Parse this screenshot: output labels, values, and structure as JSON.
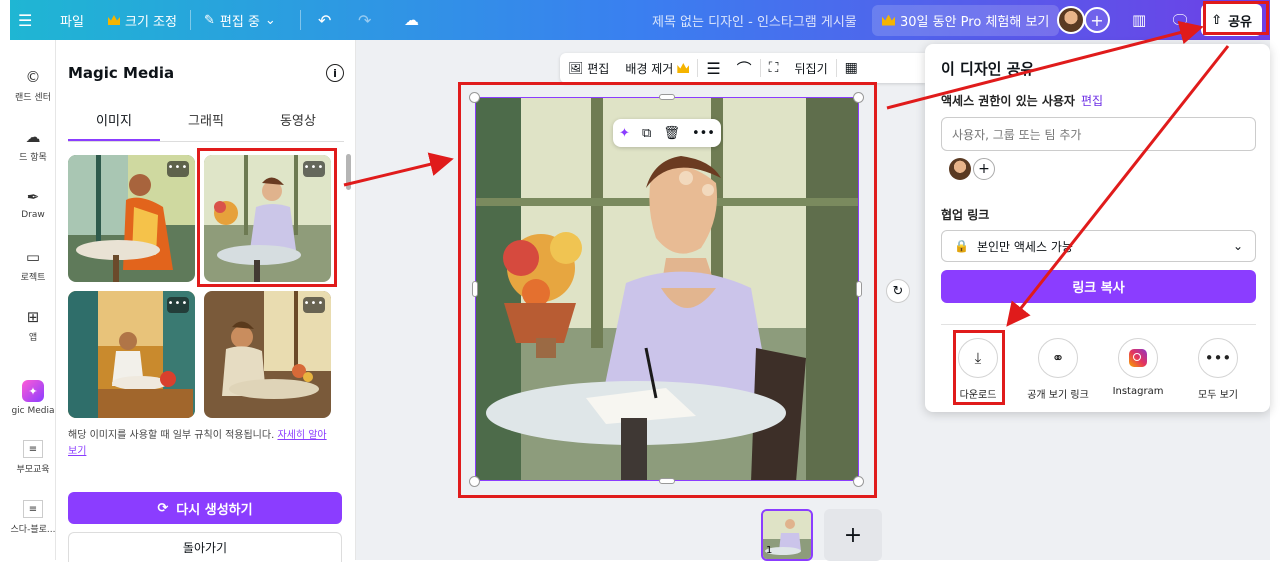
{
  "topbar": {
    "file": "파일",
    "resize": "크기 조정",
    "editing": "편집 중",
    "doc_title": "제목 없는 디자인 - 인스타그램 게시물",
    "pro_trial": "30일 동안 Pro 체험해 보기",
    "share": "공유"
  },
  "rail": {
    "items": [
      {
        "label": "랜드 센터",
        "icon": "brand-icon"
      },
      {
        "label": "드 항목",
        "icon": "upload-cloud-icon"
      },
      {
        "label": "Draw",
        "icon": "draw-pen-icon"
      },
      {
        "label": "로젝트",
        "icon": "folder-icon"
      },
      {
        "label": "앱",
        "icon": "apps-grid-icon"
      },
      {
        "label": "gic Media",
        "icon": "magic-media-icon"
      },
      {
        "label": "부모교육",
        "icon": "app-thumbnail-icon"
      },
      {
        "label": "스다-블로...",
        "icon": "app-thumbnail-icon"
      }
    ]
  },
  "panel": {
    "title": "Magic Media",
    "tabs": [
      "이미지",
      "그래픽",
      "동영상"
    ],
    "active_tab": "이미지",
    "more": "•••",
    "note": "해당 이미지를 사용할 때 일부 규칙이 적용됩니다.",
    "note_link": "자세히 알아보기",
    "regenerate": "다시 생성하기",
    "back": "돌아가기"
  },
  "context_toolbar": {
    "edit": "편집",
    "bg_remove": "배경 제거",
    "flip": "뒤집기"
  },
  "pages": {
    "current": "1",
    "add": "+"
  },
  "share_panel": {
    "title": "이 디자인 공유",
    "access_label": "액세스 권한이 있는 사용자",
    "access_edit": "편집",
    "people_placeholder": "사용자, 그룹 또는 팀 추가",
    "collab_label": "협업 링크",
    "access_option": "본인만 액세스 가능",
    "copy_link": "링크 복사",
    "options": [
      {
        "label": "다운로드",
        "icon": "download-icon"
      },
      {
        "label": "공개 보기 링크",
        "icon": "link-icon"
      },
      {
        "label": "Instagram",
        "icon": "instagram-icon"
      },
      {
        "label": "모두 보기",
        "icon": "more-icon"
      }
    ]
  },
  "colors": {
    "accent": "#8b3dff",
    "annotation": "#e01b1b"
  }
}
